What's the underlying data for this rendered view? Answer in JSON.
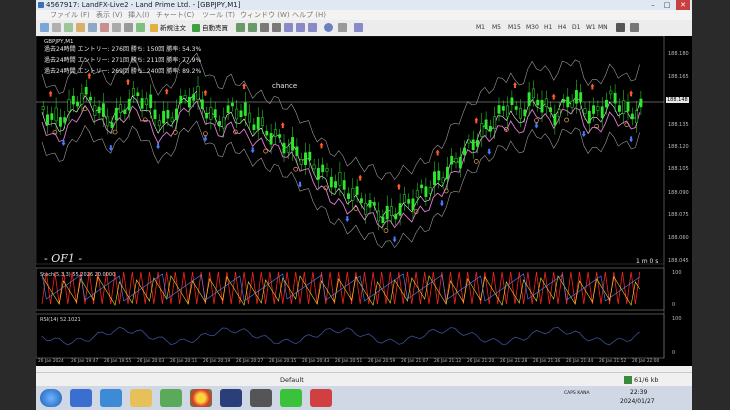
{
  "window": {
    "title": "4567917: LandFX-Live2 - Land Prime Ltd. - [GBPJPY,M1]",
    "min": "–",
    "max": "□",
    "close": "✕"
  },
  "menu": [
    "ファイル (F)",
    "表示 (V)",
    "挿入(I)",
    "チャート(C)",
    "ツール (T)",
    "ウィンドウ (W)",
    "ヘルプ (H)"
  ],
  "toolbar": {
    "new_order": "新規注文",
    "auto_trade": "自動売買",
    "timeframes": [
      "M1",
      "M5",
      "M15",
      "M30",
      "H1",
      "H4",
      "D1",
      "W1",
      "MN"
    ]
  },
  "chart": {
    "symbol": "GBPJPY,M1",
    "stats": [
      {
        "period": "過去24時間",
        "entries": "エントリー: 276回",
        "wins": "勝ち: 150回",
        "rate": "勝率: 54.3%"
      },
      {
        "period": "過去24時間",
        "entries": "エントリー: 271回",
        "wins": "勝ち: 211回",
        "rate": "勝率: 77.9%"
      },
      {
        "period": "過去24時間",
        "entries": "エントリー: 269回",
        "wins": "勝ち: 240回",
        "rate": "勝率: 89.2%"
      }
    ],
    "chance": "chance",
    "brand": "- OF1 -",
    "timer": "1 m 0 s",
    "current_price": "188.148",
    "price_axis": [
      "188.180",
      "188.165",
      "188.150",
      "188.135",
      "188.120",
      "188.105",
      "188.090",
      "188.075",
      "188.060",
      "188.045"
    ],
    "stoch_label": "Stoch(5,3,3) 55.2026 20.0000",
    "stoch_axis": [
      "100",
      "0"
    ],
    "rsi_label": "RSI(14) 52.1021",
    "rsi_axis": [
      "100",
      "0"
    ],
    "time_axis": [
      "26 Jan 2024",
      "26 Jan 19:47",
      "26 Jan 19:55",
      "26 Jan 20:03",
      "26 Jan 20:11",
      "26 Jan 20:19",
      "26 Jan 20:27",
      "26 Jan 20:35",
      "26 Jan 20:43",
      "26 Jan 20:51",
      "26 Jan 20:59",
      "26 Jan 21:07",
      "26 Jan 21:12",
      "26 Jan 21:20",
      "26 Jan 21:28",
      "26 Jan 21:36",
      "26 Jan 21:44",
      "26 Jan 21:52",
      "26 Jan 22:00"
    ]
  },
  "statusbar": {
    "profile": "Default",
    "traffic": "61/6 kb"
  },
  "taskbar": {
    "time": "22:39",
    "date": "2024/01/27",
    "tray": "CAPS KANA"
  },
  "colors": {
    "candle": "#2ee82e",
    "bands": "#9a9a9a",
    "ma_pink": "#e07ad0",
    "ma_white": "#f0f0f0",
    "arrow_up": "#4a7bff",
    "arrow_down": "#ff5a2a",
    "circle": "#e8a060",
    "stoch_main": "#ff2020",
    "rsi": "#3a4f9a"
  }
}
